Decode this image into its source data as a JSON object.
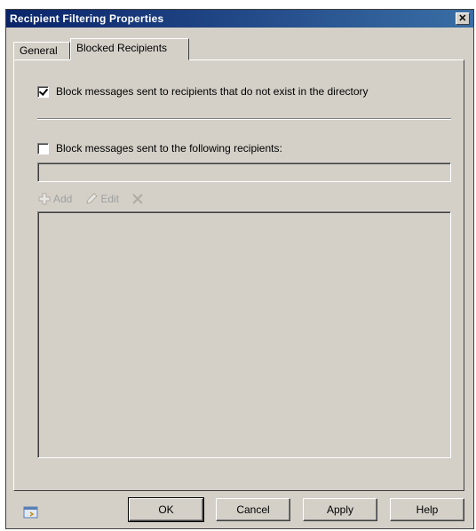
{
  "window": {
    "title": "Recipient Filtering Properties",
    "close_glyph": "✕"
  },
  "tabs": [
    {
      "label": "General",
      "active": false
    },
    {
      "label": "Blocked Recipients",
      "active": true
    }
  ],
  "options": {
    "block_nonexistent": {
      "label": "Block messages sent to recipients that do not exist in the directory",
      "checked": true
    },
    "block_following": {
      "label": "Block messages sent to the following recipients:",
      "checked": false
    }
  },
  "recipient_input": {
    "value": ""
  },
  "toolbar": {
    "add_label": "Add",
    "edit_label": "Edit",
    "add_icon": "add-icon",
    "edit_icon": "edit-icon",
    "remove_icon": "remove-icon"
  },
  "recipients_list": [],
  "buttons": {
    "ok": "OK",
    "cancel": "Cancel",
    "apply": "Apply",
    "help": "Help"
  },
  "colors": {
    "title_start": "#0a246a",
    "title_end": "#3a6ea5",
    "face": "#d4d0c8",
    "disabled_text": "#a0a0a0"
  }
}
